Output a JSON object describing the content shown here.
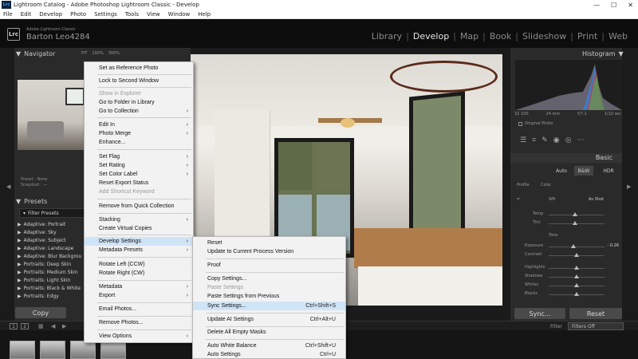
{
  "window": {
    "title": "Lightroom Catalog - Adobe Photoshop Lightroom Classic - Develop",
    "controls": [
      "—",
      "☐",
      "✕"
    ],
    "app_badge": "Lrc"
  },
  "menubar": [
    "File",
    "Edit",
    "Develop",
    "Photo",
    "Settings",
    "Tools",
    "View",
    "Window",
    "Help"
  ],
  "identity": {
    "small": "Adobe Lightroom Classic",
    "user": "Barton Leo4284"
  },
  "modules": [
    "Library",
    "Develop",
    "Map",
    "Book",
    "Slideshow",
    "Print",
    "Web"
  ],
  "active_module": "Develop",
  "left": {
    "navigator": "Navigator",
    "zoom": [
      "FIT",
      "100%",
      "300%"
    ],
    "nav_info": [
      "Preset : None",
      "Snapshot : —"
    ],
    "presets": "Presets",
    "filter": "Filter Presets",
    "preset_items": [
      "Adaptive: Portrait",
      "Adaptive: Sky",
      "Adaptive: Subject",
      "Adaptive: Landscape",
      "Adaptive: Blur Backgrou",
      "Portraits: Deep Skin",
      "Portraits: Medium Skin",
      "Portraits: Light Skin",
      "Portraits: Black & White",
      "Portraits: Edgy"
    ],
    "copy": "Copy"
  },
  "filmstrip": {
    "pages": [
      "1",
      "2"
    ],
    "filter_label": "Filter",
    "filter_value": "Filters Off"
  },
  "right": {
    "histogram": "Histogram",
    "hist_info": [
      "32 100",
      "24 mm",
      "f/7.1",
      "1/10 sec"
    ],
    "original_photo": "Original Photo",
    "basic": "Basic",
    "treatment": [
      "Auto",
      "B&W",
      "HDR"
    ],
    "profile_label": "Profile",
    "profile_value": "Color",
    "wb_label": "WB",
    "wb_value": "As Shot",
    "temp": "Temp",
    "tint": "Tint",
    "tone": "Tone",
    "exposure": "Exposure",
    "exposure_value": "- 0.26",
    "contrast": "Contrast",
    "highlights": "Highlights",
    "shadows": "Shadows",
    "whites": "Whites",
    "blacks": "Blacks",
    "sync": "Sync...",
    "reset": "Reset"
  },
  "context_menu": {
    "items": [
      {
        "label": "Set as Reference Photo",
        "disabled": false
      },
      {
        "label": "Lock to Second Window",
        "disabled": false
      },
      {
        "label": "Show in Explorer",
        "disabled": true
      },
      {
        "label": "Go to Folder in Library",
        "disabled": false
      },
      {
        "label": "Go to Collection",
        "disabled": false,
        "sub": true
      },
      {
        "label": "Edit In",
        "disabled": false,
        "sub": true
      },
      {
        "label": "Photo Merge",
        "disabled": false,
        "sub": true
      },
      {
        "label": "Enhance...",
        "disabled": false
      },
      {
        "label": "Set Flag",
        "disabled": false,
        "sub": true
      },
      {
        "label": "Set Rating",
        "disabled": false,
        "sub": true
      },
      {
        "label": "Set Color Label",
        "disabled": false,
        "sub": true
      },
      {
        "label": "Reset Export Status",
        "disabled": false
      },
      {
        "label": "Add Shortcut Keyword",
        "disabled": true
      },
      {
        "label": "Remove from Quick Collection",
        "disabled": false
      },
      {
        "label": "Stacking",
        "disabled": false,
        "sub": true
      },
      {
        "label": "Create Virtual Copies",
        "disabled": false
      },
      {
        "label": "Develop Settings",
        "disabled": false,
        "sub": true,
        "hl": true
      },
      {
        "label": "Metadata Presets",
        "disabled": false,
        "sub": true
      },
      {
        "label": "Rotate Left (CCW)",
        "disabled": false
      },
      {
        "label": "Rotate Right (CW)",
        "disabled": false
      },
      {
        "label": "Metadata",
        "disabled": false,
        "sub": true
      },
      {
        "label": "Export",
        "disabled": false,
        "sub": true
      },
      {
        "label": "Email Photos...",
        "disabled": false
      },
      {
        "label": "Remove Photos...",
        "disabled": false
      },
      {
        "label": "View Options",
        "disabled": false,
        "sub": true
      }
    ]
  },
  "submenu": {
    "items": [
      {
        "label": "Reset",
        "shortcut": "",
        "disabled": false
      },
      {
        "label": "Update to Current Process Version",
        "shortcut": "",
        "disabled": false
      },
      {
        "label": "Proof",
        "shortcut": "",
        "disabled": false
      },
      {
        "label": "Copy Settings...",
        "shortcut": "",
        "disabled": false
      },
      {
        "label": "Paste Settings",
        "shortcut": "",
        "disabled": true
      },
      {
        "label": "Paste Settings from Previous",
        "shortcut": "",
        "disabled": false
      },
      {
        "label": "Sync Settings...",
        "shortcut": "Ctrl+Shift+S",
        "disabled": false,
        "hl": true
      },
      {
        "label": "Update AI Settings",
        "shortcut": "Ctrl+Alt+U",
        "disabled": false
      },
      {
        "label": "Delete All Empty Masks",
        "shortcut": "",
        "disabled": false
      },
      {
        "label": "Auto White Balance",
        "shortcut": "Ctrl+Shift+U",
        "disabled": false
      },
      {
        "label": "Auto Settings",
        "shortcut": "Ctrl+U",
        "disabled": false
      }
    ]
  },
  "colors": {
    "accent": "#31a8ff",
    "menu_bg": "#f2f2f2",
    "highlight": "#cfe4f7"
  }
}
